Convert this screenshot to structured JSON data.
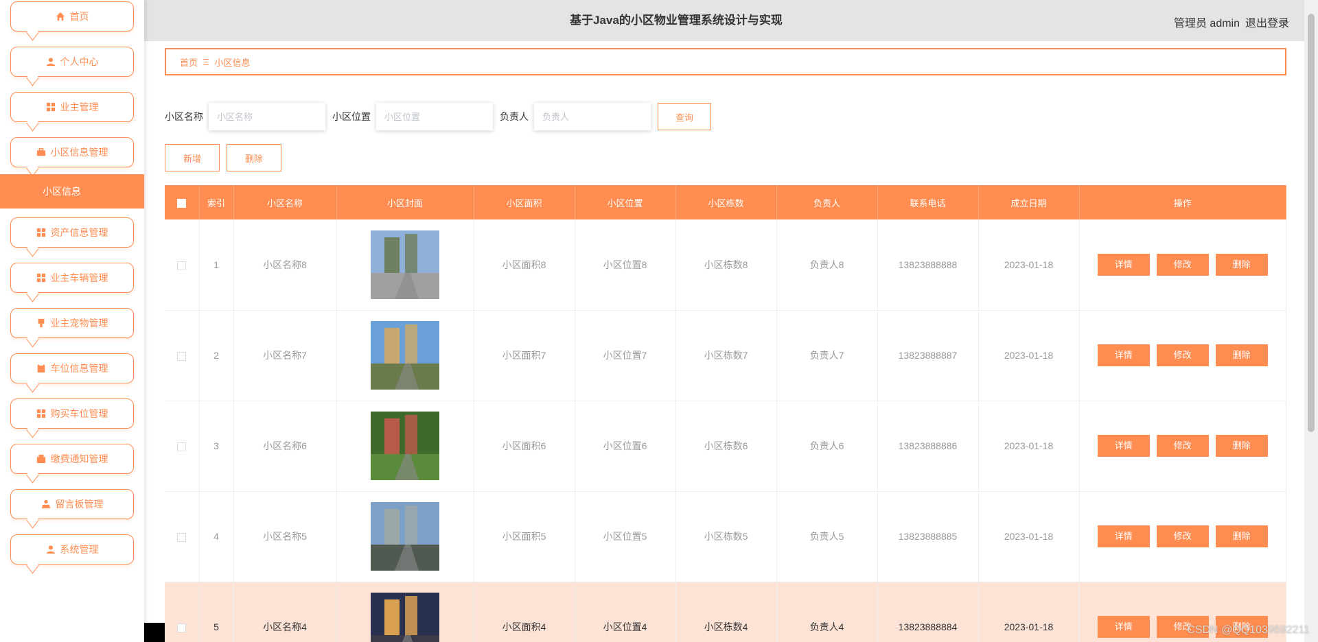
{
  "header": {
    "title": "基于Java的小区物业管理系统设计与实现",
    "user": "管理员 admin",
    "logout": "退出登录"
  },
  "sidebar": {
    "items": [
      {
        "label": "首页",
        "icon": "home-icon"
      },
      {
        "label": "个人中心",
        "icon": "user-icon"
      },
      {
        "label": "业主管理",
        "icon": "grid-icon"
      },
      {
        "label": "小区信息管理",
        "icon": "briefcase-icon"
      },
      {
        "label": "资产信息管理",
        "icon": "grid-icon"
      },
      {
        "label": "业主车辆管理",
        "icon": "grid-icon"
      },
      {
        "label": "业主宠物管理",
        "icon": "marker-icon"
      },
      {
        "label": "车位信息管理",
        "icon": "clipboard-icon"
      },
      {
        "label": "购买车位管理",
        "icon": "grid-icon"
      },
      {
        "label": "缴费通知管理",
        "icon": "wallet-icon"
      },
      {
        "label": "留言板管理",
        "icon": "stamp-icon"
      },
      {
        "label": "系统管理",
        "icon": "user-icon"
      }
    ],
    "active_sub": "小区信息"
  },
  "breadcrumb": {
    "home": "首页",
    "sep": "Ξ",
    "current": "小区信息"
  },
  "search": {
    "name_label": "小区名称",
    "name_placeholder": "小区名称",
    "location_label": "小区位置",
    "location_placeholder": "小区位置",
    "manager_label": "负责人",
    "manager_placeholder": "负责人",
    "query_button": "查询"
  },
  "actions": {
    "new_button": "新增",
    "delete_button": "删除"
  },
  "table": {
    "columns": [
      "索引",
      "小区名称",
      "小区封面",
      "小区面积",
      "小区位置",
      "小区栋数",
      "负责人",
      "联系电话",
      "成立日期",
      "操作"
    ],
    "op_labels": {
      "detail": "详情",
      "edit": "修改",
      "delete": "删除"
    },
    "rows": [
      {
        "index": "1",
        "name": "小区名称8",
        "area": "小区面积8",
        "location": "小区位置8",
        "buildings": "小区栋数8",
        "manager": "负责人8",
        "phone": "13823888888",
        "date": "2023-01-18"
      },
      {
        "index": "2",
        "name": "小区名称7",
        "area": "小区面积7",
        "location": "小区位置7",
        "buildings": "小区栋数7",
        "manager": "负责人7",
        "phone": "13823888887",
        "date": "2023-01-18"
      },
      {
        "index": "3",
        "name": "小区名称6",
        "area": "小区面积6",
        "location": "小区位置6",
        "buildings": "小区栋数6",
        "manager": "负责人6",
        "phone": "13823888886",
        "date": "2023-01-18"
      },
      {
        "index": "4",
        "name": "小区名称5",
        "area": "小区面积5",
        "location": "小区位置5",
        "buildings": "小区栋数5",
        "manager": "负责人5",
        "phone": "13823888885",
        "date": "2023-01-18"
      },
      {
        "index": "5",
        "name": "小区名称4",
        "area": "小区面积4",
        "location": "小区位置4",
        "buildings": "小区栋数4",
        "manager": "负责人4",
        "phone": "13823888884",
        "date": "2023-01-18"
      }
    ]
  },
  "watermark": "CSDN @QQ1039692211",
  "colors": {
    "accent": "#ff8c50",
    "highlight_row": "#fde3d6",
    "header_bg": "#e4e4e4"
  }
}
